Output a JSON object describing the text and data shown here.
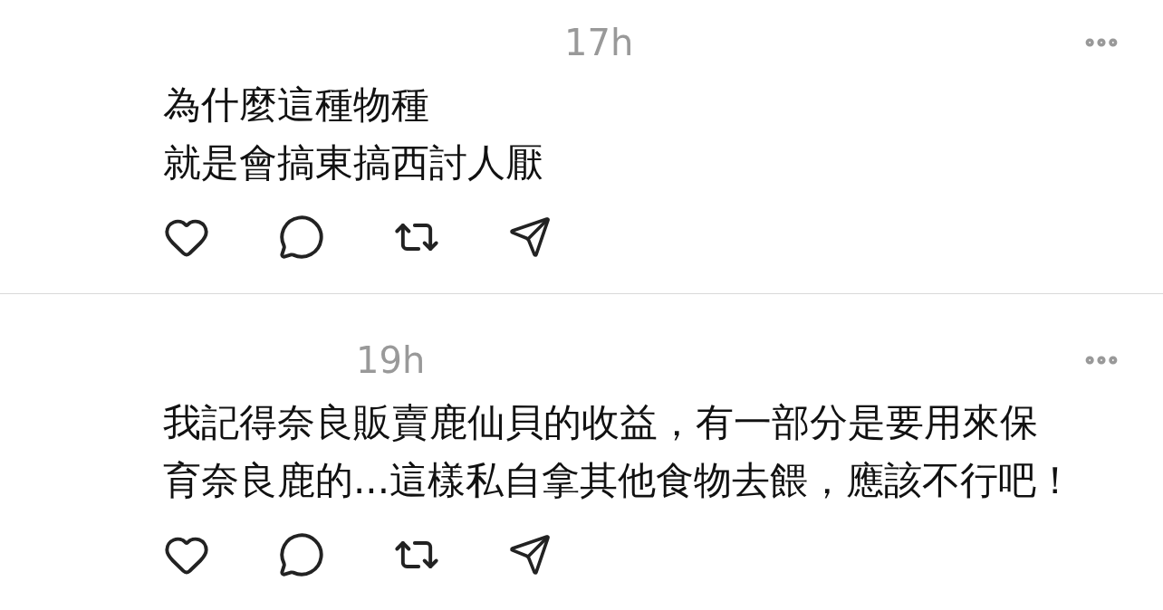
{
  "posts": [
    {
      "time": "17h",
      "lines": [
        "為什麼這種物種",
        "就是會搞東搞西討人厭"
      ]
    },
    {
      "time": "19h",
      "lines": [
        "我記得奈良販賣鹿仙貝的收益，有一部分是要用來保",
        "育奈良鹿的...這樣私自拿其他食物去餵，應該不行吧！"
      ]
    }
  ]
}
